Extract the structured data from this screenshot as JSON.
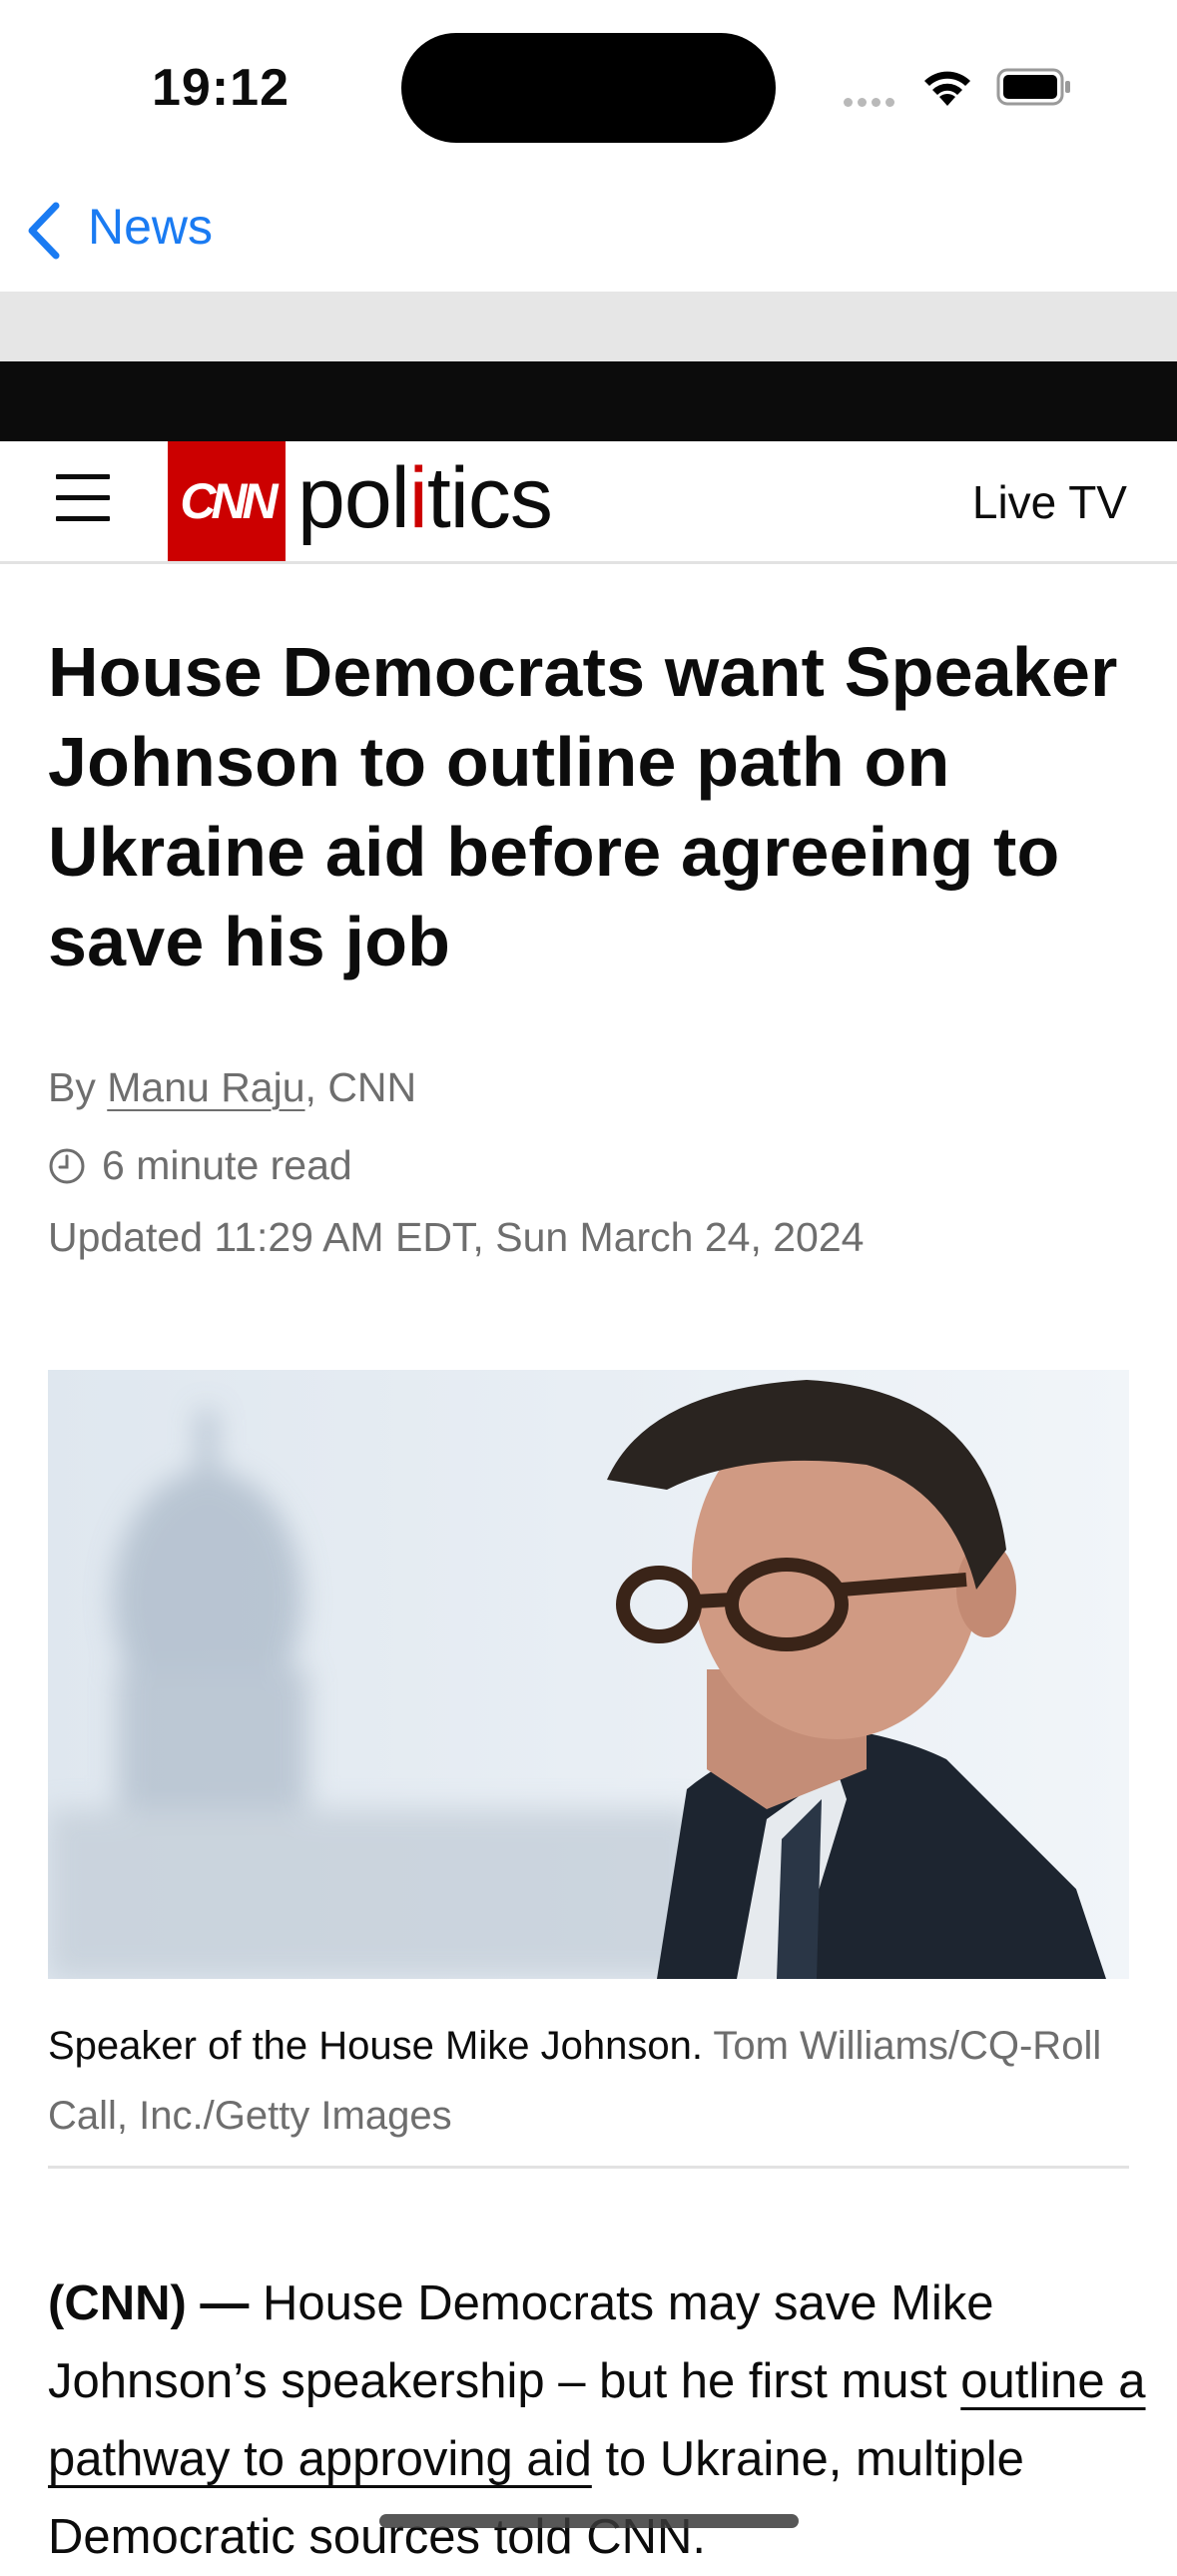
{
  "status_bar": {
    "time": "19:12"
  },
  "nav": {
    "back_label": "News"
  },
  "cnn_header": {
    "logo_text": "CNN",
    "section": "politics",
    "live_tv": "Live TV"
  },
  "article": {
    "headline": "House Democrats want Speaker Johnson to outline path on Ukraine aid before agreeing to save his job",
    "byline_prefix": "By ",
    "author": "Manu Raju",
    "byline_suffix": ", CNN",
    "read_time": "6 minute read",
    "updated": "Updated 11:29 AM EDT, Sun March 24, 2024",
    "caption": "Speaker of the House Mike Johnson.",
    "credit": "Tom Williams/CQ-Roll Call, Inc./Getty Images",
    "lead": "(CNN) —",
    "body_part1": " House Democrats may save Mike Johnson’s speakership – but he first must ",
    "body_link": "outline a pathway to approving aid",
    "body_part2": " to Ukraine, multiple Democratic sources told CNN."
  },
  "colors": {
    "accent_link": "#1a7bf2",
    "cnn_red": "#cc0000"
  },
  "icons": [
    "wifi-icon",
    "battery-icon",
    "chevron-left-icon",
    "hamburger-menu-icon",
    "clock-icon"
  ]
}
